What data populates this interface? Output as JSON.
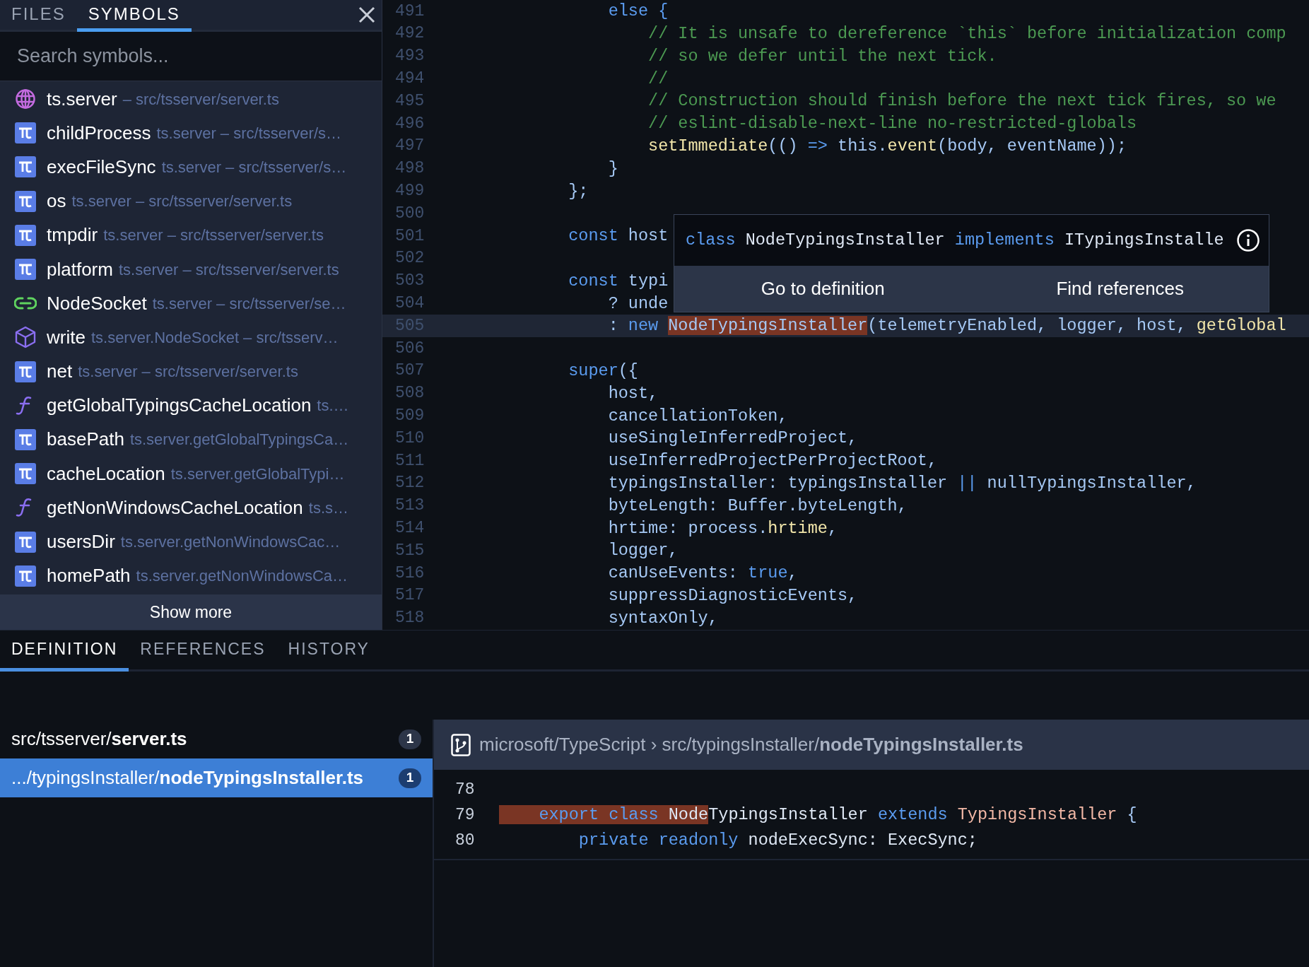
{
  "sidebar": {
    "tabs": [
      {
        "label": "FILES",
        "selected": false
      },
      {
        "label": "SYMBOLS",
        "selected": true
      }
    ],
    "search": {
      "placeholder": "Search symbols..."
    },
    "symbols": [
      {
        "kind": "namespace",
        "name": "ts.server",
        "detail": "– src/tsserver/server.ts"
      },
      {
        "kind": "variable",
        "name": "childProcess",
        "detail": "ts.server – src/tsserver/s…"
      },
      {
        "kind": "variable",
        "name": "execFileSync",
        "detail": "ts.server – src/tsserver/s…"
      },
      {
        "kind": "variable",
        "name": "os",
        "detail": "ts.server – src/tsserver/server.ts"
      },
      {
        "kind": "variable",
        "name": "tmpdir",
        "detail": "ts.server – src/tsserver/server.ts"
      },
      {
        "kind": "variable",
        "name": "platform",
        "detail": "ts.server – src/tsserver/server.ts"
      },
      {
        "kind": "class",
        "name": "NodeSocket",
        "detail": "ts.server – src/tsserver/se…"
      },
      {
        "kind": "method",
        "name": "write",
        "detail": "ts.server.NodeSocket – src/tsserv…"
      },
      {
        "kind": "variable",
        "name": "net",
        "detail": "ts.server – src/tsserver/server.ts"
      },
      {
        "kind": "function",
        "name": "getGlobalTypingsCacheLocation",
        "detail": "ts.…"
      },
      {
        "kind": "variable",
        "name": "basePath",
        "detail": "ts.server.getGlobalTypingsCa…"
      },
      {
        "kind": "variable",
        "name": "cacheLocation",
        "detail": "ts.server.getGlobalTypi…"
      },
      {
        "kind": "function",
        "name": "getNonWindowsCacheLocation",
        "detail": "ts.s…"
      },
      {
        "kind": "variable",
        "name": "usersDir",
        "detail": "ts.server.getNonWindowsCac…"
      },
      {
        "kind": "variable",
        "name": "homePath",
        "detail": "ts.server.getNonWindowsCa…"
      }
    ],
    "show_more": "Show more"
  },
  "editor": {
    "lines": [
      {
        "number": "491",
        "selected": false,
        "tokens": [
          {
            "text": "                else {",
            "kind": "keyword"
          }
        ]
      },
      {
        "number": "492",
        "selected": false,
        "tokens": [
          {
            "text": "                    // It is unsafe to dereference `this` before initialization comp",
            "kind": "comment"
          }
        ]
      },
      {
        "number": "493",
        "selected": false,
        "tokens": [
          {
            "text": "                    // so we defer until the next tick.",
            "kind": "comment"
          }
        ]
      },
      {
        "number": "494",
        "selected": false,
        "tokens": [
          {
            "text": "                    //",
            "kind": "comment"
          }
        ]
      },
      {
        "number": "495",
        "selected": false,
        "tokens": [
          {
            "text": "                    // Construction should finish before the next tick fires, so we",
            "kind": "comment"
          }
        ]
      },
      {
        "number": "496",
        "selected": false,
        "tokens": [
          {
            "text": "                    // eslint-disable-next-line no-restricted-globals",
            "kind": "comment"
          }
        ]
      },
      {
        "number": "497",
        "selected": false,
        "tokens": [
          {
            "text": "                    setImmediate",
            "kind": "function"
          },
          {
            "text": "(() ",
            "kind": "identifier"
          },
          {
            "text": "=>",
            "kind": "keyword"
          },
          {
            "text": " this.",
            "kind": "identifier"
          },
          {
            "text": "event",
            "kind": "function"
          },
          {
            "text": "(body, eventName));",
            "kind": "identifier"
          }
        ]
      },
      {
        "number": "498",
        "selected": false,
        "tokens": [
          {
            "text": "                }",
            "kind": "identifier"
          }
        ]
      },
      {
        "number": "499",
        "selected": false,
        "tokens": [
          {
            "text": "            };",
            "kind": "identifier"
          }
        ]
      },
      {
        "number": "500",
        "selected": false
      },
      {
        "number": "501",
        "selected": false,
        "tokens": [
          {
            "text": "            const",
            "kind": "keyword"
          },
          {
            "text": " host",
            "kind": "identifier"
          }
        ]
      },
      {
        "number": "502",
        "selected": false
      },
      {
        "number": "503",
        "selected": false,
        "tokens": [
          {
            "text": "            const",
            "kind": "keyword"
          },
          {
            "text": " typi",
            "kind": "identifier"
          }
        ]
      },
      {
        "number": "504",
        "selected": false,
        "tokens": [
          {
            "text": "                ? unde",
            "kind": "identifier"
          }
        ]
      },
      {
        "number": "505",
        "selected": true,
        "tokens": [
          {
            "text": "                : ",
            "kind": "identifier"
          },
          {
            "text": "new ",
            "kind": "keyword"
          },
          {
            "text": "NodeTypingsInstaller",
            "kind": "match"
          },
          {
            "text": "(telemetryEnabled, logger, host, ",
            "kind": "identifier"
          },
          {
            "text": "getGlobal",
            "kind": "function"
          }
        ]
      },
      {
        "number": "506",
        "selected": false
      },
      {
        "number": "507",
        "selected": false,
        "tokens": [
          {
            "text": "            super",
            "kind": "keyword"
          },
          {
            "text": "({",
            "kind": "identifier"
          }
        ]
      },
      {
        "number": "508",
        "selected": false,
        "tokens": [
          {
            "text": "                host,",
            "kind": "identifier"
          }
        ]
      },
      {
        "number": "509",
        "selected": false,
        "tokens": [
          {
            "text": "                cancellationToken,",
            "kind": "identifier"
          }
        ]
      },
      {
        "number": "510",
        "selected": false,
        "tokens": [
          {
            "text": "                useSingleInferredProject,",
            "kind": "identifier"
          }
        ]
      },
      {
        "number": "511",
        "selected": false,
        "tokens": [
          {
            "text": "                useInferredProjectPerProjectRoot,",
            "kind": "identifier"
          }
        ]
      },
      {
        "number": "512",
        "selected": false,
        "tokens": [
          {
            "text": "                typingsInstaller: typingsInstaller ",
            "kind": "identifier"
          },
          {
            "text": "||",
            "kind": "keyword"
          },
          {
            "text": " nullTypingsInstaller,",
            "kind": "identifier"
          }
        ]
      },
      {
        "number": "513",
        "selected": false,
        "tokens": [
          {
            "text": "                byteLength: Buffer.byteLength,",
            "kind": "identifier"
          }
        ]
      },
      {
        "number": "514",
        "selected": false,
        "tokens": [
          {
            "text": "                hrtime: process.",
            "kind": "identifier"
          },
          {
            "text": "hrtime",
            "kind": "function"
          },
          {
            "text": ",",
            "kind": "identifier"
          }
        ]
      },
      {
        "number": "515",
        "selected": false,
        "tokens": [
          {
            "text": "                logger,",
            "kind": "identifier"
          }
        ]
      },
      {
        "number": "516",
        "selected": false,
        "tokens": [
          {
            "text": "                canUseEvents: ",
            "kind": "identifier"
          },
          {
            "text": "true",
            "kind": "keyword"
          },
          {
            "text": ",",
            "kind": "identifier"
          }
        ]
      },
      {
        "number": "517",
        "selected": false,
        "tokens": [
          {
            "text": "                suppressDiagnosticEvents,",
            "kind": "identifier"
          }
        ]
      },
      {
        "number": "518",
        "selected": false,
        "tokens": [
          {
            "text": "                syntaxOnly,",
            "kind": "identifier"
          }
        ]
      }
    ],
    "popover": {
      "signature": [
        {
          "text": "class ",
          "kind": "keyword"
        },
        {
          "text": "NodeTypingsInstaller ",
          "kind": "plain"
        },
        {
          "text": "implements ",
          "kind": "keyword"
        },
        {
          "text": "ITypingsInstalle",
          "kind": "plain"
        }
      ],
      "actions": [
        "Go to definition",
        "Find references"
      ]
    }
  },
  "panel": {
    "tabs": [
      {
        "label": "DEFINITION",
        "selected": true
      },
      {
        "label": "REFERENCES",
        "selected": false
      },
      {
        "label": "HISTORY",
        "selected": false
      }
    ],
    "files": [
      {
        "path": "src/tsserver/**server.ts**",
        "count": "1",
        "selected": false
      },
      {
        "path": ".../typingsInstaller/**nodeTypingsInstaller.ts**",
        "count": "1",
        "selected": true
      }
    ],
    "breadcrumb": "microsoft/TypeScript › src/typingsInstaller/**nodeTypingsInstaller.ts**",
    "lines": [
      {
        "number": "78"
      },
      {
        "number": "79",
        "tokens": [
          {
            "text": "    export class ",
            "kind": "keyword",
            "highlighted": true
          },
          {
            "text": "Node",
            "kind": "plain",
            "highlighted": true
          },
          {
            "text": "TypingsInstaller ",
            "kind": "plain",
            "highlighted": false
          },
          {
            "text": "extends ",
            "kind": "keyword",
            "highlighted": false
          },
          {
            "text": "TypingsInstaller ",
            "kind": "type",
            "highlighted": false
          },
          {
            "text": "{",
            "kind": "identifier",
            "highlighted": false
          }
        ]
      },
      {
        "number": "80",
        "tokens": [
          {
            "text": "        private readonly ",
            "kind": "keyword",
            "highlighted": false
          },
          {
            "text": "nodeExecSync: ExecSync;",
            "kind": "plain",
            "highlighted": false
          }
        ]
      }
    ]
  }
}
